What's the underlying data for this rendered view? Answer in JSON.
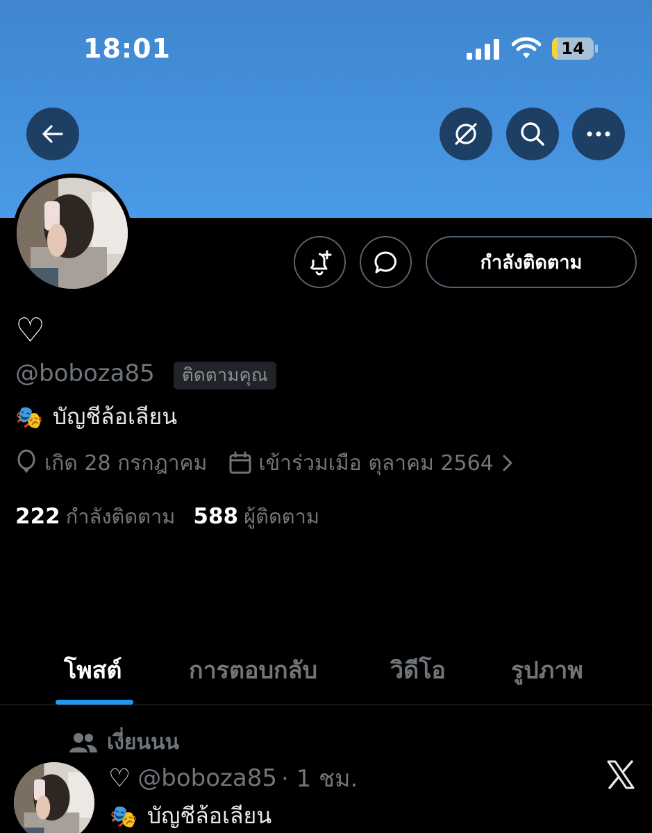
{
  "status_bar": {
    "time": "18:01",
    "battery_level": "14",
    "battery_fraction": 0.14
  },
  "header": {
    "back_icon": "arrow-left-icon",
    "grok_icon": "slashed-circle-icon",
    "search_icon": "search-icon",
    "more_icon": "more-horizontal-icon"
  },
  "profile": {
    "display_name": "♡",
    "handle": "@boboza85",
    "follows_you_badge": "ติดตามคุณ",
    "bio_emoji": "🎭",
    "bio": "บัญชีล้อเลียน",
    "birthday": "เกิด 28 กรกฎาคม",
    "joined": "เข้าร่วมเมือ ตุลาคม 2564",
    "following_count": "222",
    "following_label": "กำลังติดตาม",
    "followers_count": "588",
    "followers_label": "ผู้ติดตาม",
    "follow_button_label": "กำลังติดตาม"
  },
  "tabs": [
    {
      "label": "โพสต์",
      "active": true
    },
    {
      "label": "การตอบกลับ",
      "active": false
    },
    {
      "label": "วิดีโอ",
      "active": false
    },
    {
      "label": "รูปภาพ",
      "active": false
    }
  ],
  "post": {
    "repost_by": "เงี่ยนนน",
    "name": "♡",
    "handle": "@boboza85",
    "time": "· 1 ชม.",
    "bio_emoji": "🎭",
    "bio": "บัญชีล้อเลียน"
  },
  "colors": {
    "banner": "#4a9ae8",
    "accent": "#1d9bf0",
    "muted_text": "#71767b",
    "border": "#536471"
  }
}
